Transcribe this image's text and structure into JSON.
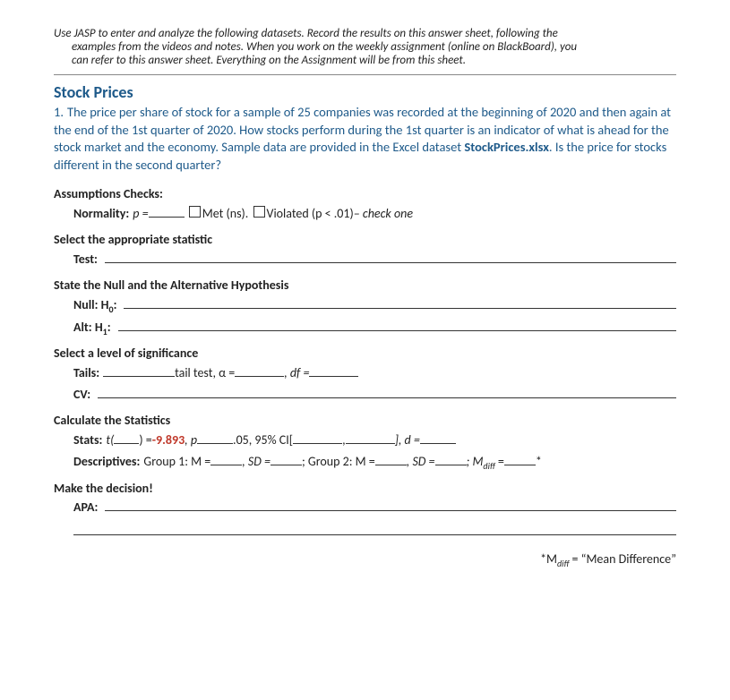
{
  "instructions": {
    "line1": "Use JASP to enter and analyze the following datasets. Record the results on this answer sheet, following the",
    "line2": "examples from the videos and notes. When you work on the weekly assignment (online on BlackBoard), you",
    "line3": "can refer to this answer sheet. Everything on the Assignment will be from this sheet."
  },
  "section_title": "Stock Prices",
  "question": {
    "number": "1.",
    "text_a": "The price per share of stock for a sample of 25 companies was recorded at the beginning of 2020 and then again at the end of the 1st quarter of 2020. How stocks perform during the 1st quarter is an indicator of what is ahead for the stock market and the economy. Sample data are provided in the Excel dataset ",
    "file": "StockPrices.xlsx",
    "text_b": ". Is the price for stocks different in the second quarter?"
  },
  "labels": {
    "assumptions": "Assumptions Checks:",
    "normality": "Normality:",
    "p_eq": "p =",
    "met": "Met (ns).",
    "violated": "Violated (p < .01)",
    "check_one": " – check one",
    "select_stat": "Select the appropriate statistic",
    "test": "Test:",
    "state_hyp": "State the Null and the Alternative Hypothesis",
    "null": "Null:",
    "h0": "H",
    "h0s": "0",
    "colon": ":",
    "alt": "Alt:",
    "h1": "H",
    "h1s": "1",
    "select_sig": "Select a level of significance",
    "tails": "Tails:",
    "tail_test": "tail test, α =",
    "df_eq": ", df =",
    "cv": "CV:",
    "calc": "Calculate the Statistics",
    "stats": "Stats:",
    "t_open": "t(",
    "t_close": ") = ",
    "t_value": "-9.893",
    "p_comma": ", p",
    "alpha_05": ".05, 95% CI[",
    "ci_comma": ",",
    "ci_close": "], d =",
    "descriptives": "Descriptives:",
    "g1": "Group 1:  M =",
    "sd_eq": ", SD =",
    "g2": "; Group 2:  M =",
    "mdiff": "; M",
    "mdiff_sub": "diff",
    "eq": "=",
    "star": "*",
    "decision": "Make the decision!",
    "apa": "APA:",
    "footnote_pre": "*M",
    "footnote_sub": "diff",
    "footnote_post": " = “Mean Difference”"
  }
}
